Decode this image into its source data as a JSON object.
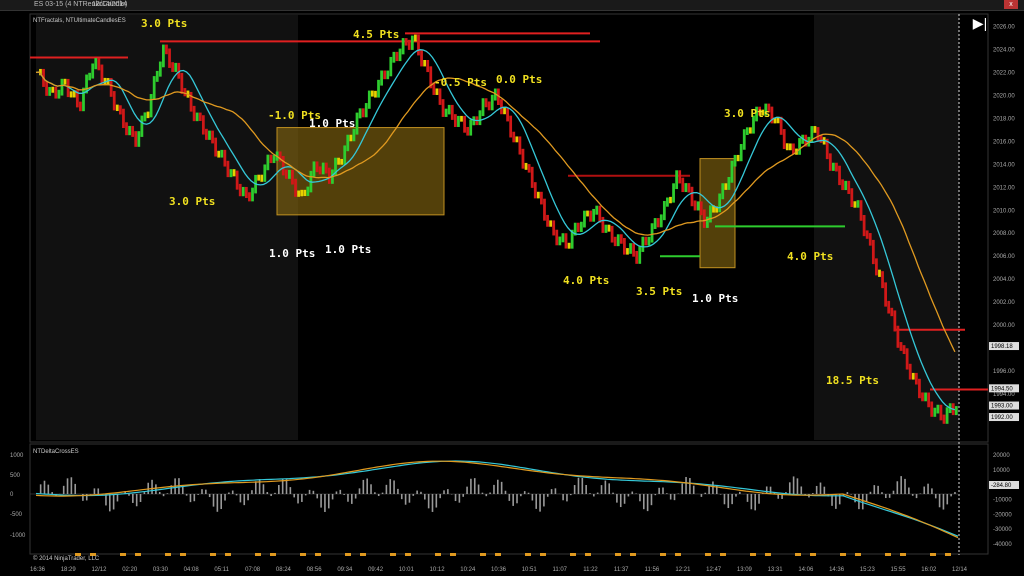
{
  "window": {
    "title": "ES 03-15 (4 NTRenkoCandle)",
    "date": "12/14/2014",
    "close_label": "x"
  },
  "price_panel": {
    "indicator_label": "NTFractals, NTUltimateCandlesES"
  },
  "oscillator_panel": {
    "indicator_label": "NTDeltaCrossES"
  },
  "copyright": "© 2014 NinjaTrader, LLC",
  "chart_data": [
    {
      "type": "candlestick",
      "ylim": [
        1990,
        2027
      ],
      "y_ticks": [
        2026,
        2024,
        2022,
        2020,
        2018,
        2016,
        2014,
        2012,
        2010,
        2008,
        2006,
        2004,
        2002,
        2000,
        1998,
        1996,
        1994,
        1992
      ],
      "price_markers": [
        "1998.18",
        "1994.50",
        "1993.00",
        "1992.00"
      ],
      "x_ticks": [
        "16:36",
        "18:29",
        "12/12",
        "02:20",
        "03:30",
        "04:08",
        "05:11",
        "07:08",
        "08:24",
        "08:56",
        "09:34",
        "09:42",
        "10:01",
        "10:12",
        "10:24",
        "10:36",
        "10:51",
        "11:07",
        "11:22",
        "11:37",
        "11:56",
        "12:21",
        "12:47",
        "13:09",
        "13:31",
        "14:06",
        "14:36",
        "15:23",
        "15:55",
        "16:02",
        "12/14"
      ],
      "close_path": [
        2022,
        2020,
        2021,
        2019,
        2023,
        2021,
        2018,
        2016,
        2019,
        2024,
        2022,
        2019,
        2017,
        2015,
        2013,
        2011,
        2013,
        2015,
        2013,
        2011,
        2014,
        2013,
        2015,
        2018,
        2020,
        2022,
        2024,
        2025,
        2022,
        2019,
        2018,
        2017,
        2019,
        2020,
        2017,
        2014,
        2011,
        2008,
        2007,
        2009,
        2010,
        2008,
        2007,
        2006,
        2008,
        2010,
        2013,
        2011,
        2009,
        2011,
        2014,
        2017,
        2019,
        2018,
        2015,
        2016,
        2017,
        2014,
        2012,
        2010,
        2006,
        2002,
        1998,
        1995,
        1993,
        1992,
        1993
      ],
      "annotations": [
        {
          "text": "3.0 Pts",
          "color": "yellow"
        },
        {
          "text": "4.5 Pts",
          "color": "yellow"
        },
        {
          "text": "-0.5 Pts",
          "color": "yellow"
        },
        {
          "text": "0.0 Pts",
          "color": "yellow"
        },
        {
          "text": "-1.0 Pts",
          "color": "yellow"
        },
        {
          "text": "1.0 Pts",
          "color": "white"
        },
        {
          "text": "3.0 Pts",
          "color": "yellow"
        },
        {
          "text": "1.0 Pts",
          "color": "white"
        },
        {
          "text": "1.0 Pts",
          "color": "white"
        },
        {
          "text": "3.0 Pts",
          "color": "yellow"
        },
        {
          "text": "4.0 Pts",
          "color": "yellow"
        },
        {
          "text": "3.5 Pts",
          "color": "yellow"
        },
        {
          "text": "1.0 Pts",
          "color": "white"
        },
        {
          "text": "4.0 Pts",
          "color": "yellow"
        },
        {
          "text": "18.5 Pts",
          "color": "yellow"
        }
      ]
    },
    {
      "type": "bar",
      "left_ticks": [
        "1000",
        "500",
        "0",
        "-500",
        "-1000"
      ],
      "right_ticks": [
        "20000",
        "10000",
        "0",
        "-10000",
        "-20000",
        "-30000",
        "-40000"
      ],
      "marker": "-284.80"
    }
  ],
  "colors": {
    "bull": "#2ecc2e",
    "bear": "#d01818",
    "neutral": "#e6d000",
    "fast_ma": "#35c8d8",
    "slow_ma": "#e09a20",
    "box": "#8a6a10",
    "label_yellow": "#f0e020",
    "label_white": "#ffffff"
  }
}
